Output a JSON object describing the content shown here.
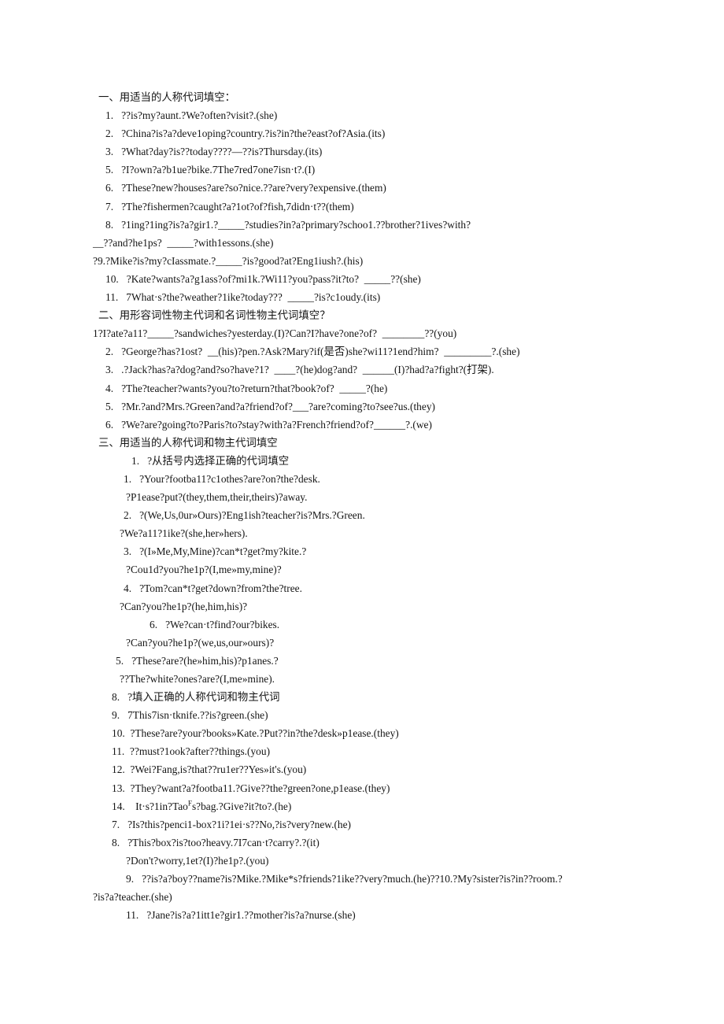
{
  "document": {
    "type": "worksheet",
    "language": "zh-CN + en",
    "lines": [
      {
        "id": "l1",
        "indent": "i-head",
        "text": "一、用适当的人称代词填空："
      },
      {
        "id": "l2",
        "indent": "i-num",
        "text": "1.   ??is?my?aunt.?We?often?visit?.(she)"
      },
      {
        "id": "l3",
        "indent": "i-num",
        "text": "2.   ?China?is?a?deve1oping?country.?is?in?the?east?of?Asia.(its)"
      },
      {
        "id": "l4",
        "indent": "i-num",
        "text": "3.   ?What?day?is??today????—??is?Thursday.(its)"
      },
      {
        "id": "l5",
        "indent": "i-num",
        "text": "5.   ?I?own?a?b1ue?bike.7The7red7one7isn·t?.(I)"
      },
      {
        "id": "l6",
        "indent": "i-num",
        "text": "6.   ?These?new?houses?are?so?nice.??are?very?expensive.(them)"
      },
      {
        "id": "l7",
        "indent": "i-num",
        "text": "7.   ?The?fishermen?caught?a?1ot?of?fish,7didn·t??(them)"
      },
      {
        "id": "l8",
        "indent": "i-num",
        "text": "8.   ?1ing?1ing?is?a?gir1.?_____?studies?in?a?primary?schoo1.??brother?1ives?with?"
      },
      {
        "id": "l9",
        "indent": "i-flush",
        "text": "__??and?he1ps?  _____?with1essons.(she)"
      },
      {
        "id": "l10",
        "indent": "i-flush",
        "text": "?9.?Mike?is?my?cIassmate.?_____?is?good?at?Eng1iush?.(his)"
      },
      {
        "id": "l11",
        "indent": "i-num",
        "text": "10.   ?Kate?wants?a?g1ass?of?mi1k.?Wi11?you?pass?it?to?  _____??(she)"
      },
      {
        "id": "l12",
        "indent": "i-num",
        "text": "11.   7What·s?the?weather?1ike?today???  _____?is?c1oudy.(its)"
      },
      {
        "id": "l13",
        "indent": "i-head",
        "text": "二、用形容词性物主代词和名词性物主代词填空？"
      },
      {
        "id": "l14",
        "indent": "i-flush",
        "text": "1?I?ate?a11?_____?sandwiches?yesterday.(I)?Can?I?have?one?of?  ________??(you)"
      },
      {
        "id": "l15",
        "indent": "i-num",
        "text": "2.   ?George?has?1ost?  __(his)?pen.?Ask?Mary?if(是否)she?wi11?1end?him?  _________?.(she)"
      },
      {
        "id": "l16",
        "indent": "i-num",
        "text": "3.   .?Jack?has?a?dog?and?so?have?1?  ____?(he)dog?and?  ______(I)?had?a?fight?(打架)."
      },
      {
        "id": "l17",
        "indent": "i-num",
        "text": "4.   ?The?teacher?wants?you?to?return?that?book?of?  _____?(he)"
      },
      {
        "id": "l18",
        "indent": "i-num",
        "text": "5.   ?Mr.?and?Mrs.?Green?and?a?friend?of?___?are?coming?to?see?us.(they)"
      },
      {
        "id": "l19",
        "indent": "i-num",
        "text": "6.   ?We?are?going?to?Paris?to?stay?with?a?French?friend?of?______?.(we)"
      },
      {
        "id": "l20",
        "indent": "i-head",
        "text": "三、用适当的人称代词和物主代词填空"
      },
      {
        "id": "l21",
        "indent": "i-s3a",
        "text": "1.   ?从括号内选择正确的代词填空"
      },
      {
        "id": "l22",
        "indent": "i-s3b",
        "text": "1.   ?Your?footba11?c1othes?are?on?the?desk."
      },
      {
        "id": "l23",
        "indent": "i-s3g",
        "text": "?P1ease?put?(they,them,their,theirs)?away."
      },
      {
        "id": "l24",
        "indent": "i-s3b",
        "text": "2.   ?(We,Us,0ur»Ours)?Eng1ish?teacher?is?Mrs.?Green."
      },
      {
        "id": "l25",
        "indent": "i-s3c",
        "text": "?We?a11?1ike?(she,her»hers)."
      },
      {
        "id": "l26",
        "indent": "i-s3b",
        "text": "3.   ?(I»Me,My,Mine)?can*t?get?my?kite.?"
      },
      {
        "id": "l27",
        "indent": "i-s3g",
        "text": "?Cou1d?you?he1p?(I,me»my,mine)?"
      },
      {
        "id": "l28",
        "indent": "i-s3b",
        "text": "4.   ?Tom?can*t?get?down?from?the?tree."
      },
      {
        "id": "l29",
        "indent": "i-s3c",
        "text": "?Can?you?he1p?(he,him,his)?"
      },
      {
        "id": "l30",
        "indent": "i-s3d",
        "text": "6.   ?We?can·t?find?our?bikes."
      },
      {
        "id": "l31",
        "indent": "i-s3g",
        "text": "?Can?you?he1p?(we,us,our»ours)?"
      },
      {
        "id": "l32",
        "indent": "i-s3e",
        "text": "5.   ?These?are?(he»him,his)?p1anes.?"
      },
      {
        "id": "l33",
        "indent": "i-s3c",
        "text": "??The?white?ones?are?(I,me»mine)."
      },
      {
        "id": "l34",
        "indent": "i-s3f",
        "text": "8.   ?填入正确的人称代词和物主代词"
      },
      {
        "id": "l35",
        "indent": "i-s3f",
        "text": "9.   7This7isn·tknife.??is?green.(she)"
      },
      {
        "id": "l36",
        "indent": "i-s3f",
        "text": "10.  ?These?are?your?books»Kate.?Put??in?the?desk»p1ease.(they)"
      },
      {
        "id": "l37",
        "indent": "i-s3f",
        "text": "11.  ??must?1ook?after??things.(you)"
      },
      {
        "id": "l38",
        "indent": "i-s3f",
        "text": "12.  ?Wei?Fang,is?that??ru1er??Yes»it's.(you)"
      },
      {
        "id": "l39",
        "indent": "i-s3f",
        "text": "13.  ?They?want?a?footba11.?Give??the?green?one,p1ease.(they)"
      },
      {
        "id": "l40",
        "indent": "i-s3f",
        "text": "14.    It·s?1in?Tao__SUP_F__s?bag.?Give?it?to?.(he)",
        "has_sup": true
      },
      {
        "id": "l41",
        "indent": "i-s3f",
        "text": "7.   ?Is?this?penci1-box?1i?1ei·s??No,?is?very?new.(he)"
      },
      {
        "id": "l42",
        "indent": "i-s3f",
        "text": "8.   ?This?box?is?too?heavy.7I7can·t?carry?.?(it)"
      },
      {
        "id": "l43",
        "indent": "i-s3g",
        "text": "?Don't?worry,1et?(I)?he1p?.(you)"
      },
      {
        "id": "l44",
        "indent": "i-s3g",
        "text": "9.   ??is?a?boy??name?is?Mike.?Mike*s?friends?1ike??very?much.(he)??10.?My?sister?is?in??room.?"
      },
      {
        "id": "l45",
        "indent": "i-flush",
        "text": "?is?a?teacher.(she)"
      },
      {
        "id": "l46",
        "indent": "i-s3g",
        "text": "11.   ?Jane?is?a?1itt1e?gir1.??mother?is?a?nurse.(she)"
      }
    ]
  }
}
